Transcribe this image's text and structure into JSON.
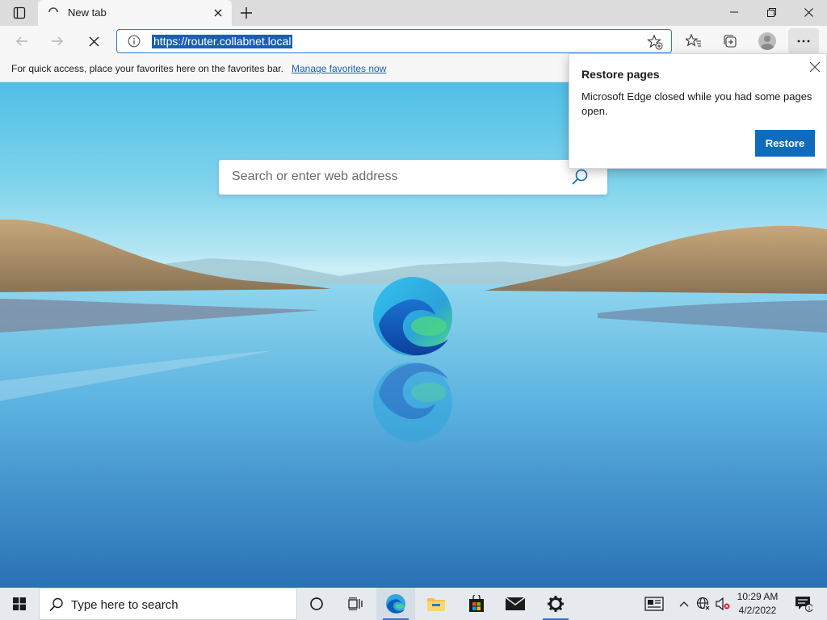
{
  "tab": {
    "title": "New tab"
  },
  "address_bar": {
    "url": "https://router.collabnet.local"
  },
  "favorites_bar": {
    "message": "For quick access, place your favorites here on the favorites bar.",
    "manage_link": "Manage favorites now"
  },
  "new_tab_page": {
    "search_placeholder": "Search or enter web address"
  },
  "restore_popup": {
    "title": "Restore pages",
    "body": "Microsoft Edge closed while you had some pages open.",
    "button": "Restore"
  },
  "taskbar": {
    "search_placeholder": "Type here to search",
    "time": "10:29 AM",
    "date": "4/2/2022",
    "notification_count": "1"
  },
  "colors": {
    "accent": "#0f6cbd",
    "selection": "#1a5fb4"
  },
  "icons": [
    "tab-actions-icon",
    "loading-spinner-icon",
    "close-icon",
    "plus-icon",
    "minimize-icon",
    "maximize-icon",
    "back-arrow-icon",
    "forward-arrow-icon",
    "stop-icon",
    "info-icon",
    "add-favorite-icon",
    "favorites-icon",
    "collections-icon",
    "profile-icon",
    "more-icon",
    "search-icon",
    "edge-logo",
    "windows-start-icon",
    "cortana-icon",
    "task-view-icon",
    "edge-icon",
    "file-explorer-icon",
    "store-icon",
    "mail-icon",
    "settings-icon",
    "news-icon",
    "chevron-up-icon",
    "network-icon",
    "volume-muted-icon",
    "notifications-icon"
  ]
}
